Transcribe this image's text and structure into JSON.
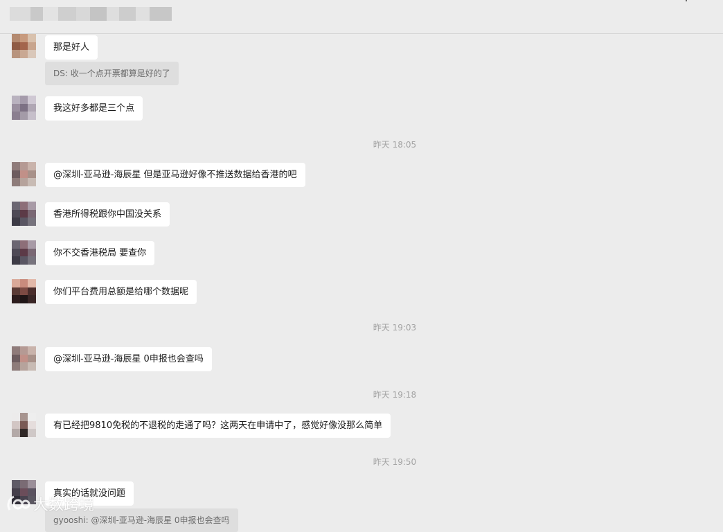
{
  "header": {
    "title_blurred": true
  },
  "messages": [
    {
      "avatar": [
        "#b48a70",
        "#c79a7e",
        "#d8c1ad",
        "#8f5b45",
        "#a3654c",
        "#c8a58e",
        "#b8947e",
        "#c9a893",
        "#d9c7b9"
      ],
      "text": "那是好人",
      "quote": "DS: 收一个点开票都算是好的了"
    },
    {
      "avatar": [
        "#b9b2bf",
        "#a59bab",
        "#cfc8d3",
        "#9a8f9f",
        "#7d7184",
        "#b0a7b4",
        "#8b7f90",
        "#a49ba8",
        "#c6bfca"
      ],
      "text": "我这好多都是三个点"
    },
    {
      "avatar": [
        "#8f7b7a",
        "#b59a94",
        "#c9b3ab",
        "#6d5c5f",
        "#c19088",
        "#a89189",
        "#8e7c7a",
        "#b6a39c",
        "#c8bbb4"
      ],
      "text": "@深圳-亚马逊-海辰星 但是亚马逊好像不推送数据给香港的吧"
    },
    {
      "avatar": [
        "#6b6672",
        "#8d6e78",
        "#a89aa6",
        "#4e4a56",
        "#5c3a47",
        "#7a6874",
        "#3d3b46",
        "#5a5663",
        "#77737d"
      ],
      "text": "香港所得税跟你中国没关系"
    },
    {
      "avatar": [
        "#6b6672",
        "#8d6e78",
        "#a89aa6",
        "#4e4a56",
        "#5c3a47",
        "#7a6874",
        "#3d3b46",
        "#5a5663",
        "#77737d"
      ],
      "text": "你不交香港税局 要查你"
    },
    {
      "avatar": [
        "#d9a999",
        "#c98b7d",
        "#e2b8a9",
        "#5a3b36",
        "#7c4a43",
        "#4a2d2c",
        "#2c1c1d",
        "#1f1516",
        "#3a2626"
      ],
      "text": "你们平台费用总额是给哪个数据呢"
    },
    {
      "avatar": [
        "#8f7b7a",
        "#b59a94",
        "#c9b3ab",
        "#6d5c5f",
        "#c19088",
        "#a89189",
        "#8e7c7a",
        "#b6a39c",
        "#c8bbb4"
      ],
      "text": "@深圳-亚马逊-海辰星 0申报也会查吗"
    },
    {
      "avatar": [
        "#ecebeb",
        "#a7948f",
        "#eeeeee",
        "#d2c6c4",
        "#7a5a55",
        "#e5dddc",
        "#b3a9a7",
        "#2f2726",
        "#cfc8c7"
      ],
      "text": "有已经把9810免税的不退税的走通了吗？这两天在申请中了，感觉好像没那么简单"
    },
    {
      "avatar": [
        "#5e5a66",
        "#7a6b74",
        "#9b8f99",
        "#453f4b",
        "#6b4d5a",
        "#5b5360",
        "#2f2c36",
        "#48434f",
        "#5c5862"
      ],
      "text": "真实的话就没问题",
      "quote": "gyooshi: @深圳-亚马逊-海辰星 0申报也会查吗"
    }
  ],
  "timestamps": [
    "昨天 18:05",
    "昨天 19:03",
    "昨天 19:18",
    "昨天 19:50"
  ],
  "watermark": {
    "text": "大数跨境"
  },
  "colors": {
    "background": "#ececec",
    "bubble": "#ffffff",
    "quote_bg": "#dedede",
    "timestamp": "#a3a3a3"
  }
}
